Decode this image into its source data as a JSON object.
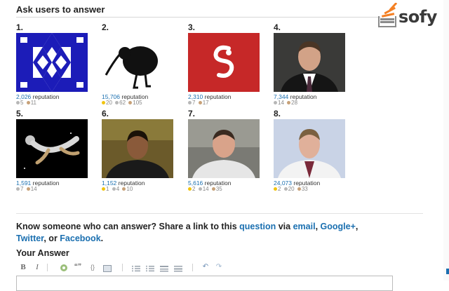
{
  "header": {
    "title": "Ask users to answer"
  },
  "logo": {
    "text": "sofy",
    "mark": "stack-icon"
  },
  "colors": {
    "link": "#1a6fb0",
    "gold": "#f1c40f",
    "silver": "#b7b7b7",
    "bronze": "#c7a178"
  },
  "users": [
    {
      "rank": "1.",
      "rep": "2,026",
      "rep_label": "reputation",
      "badges": [
        {
          "type": "silver",
          "count": "5"
        },
        {
          "type": "bronze",
          "count": "11"
        }
      ]
    },
    {
      "rank": "2.",
      "rep": "15,706",
      "rep_label": "reputation",
      "badges": [
        {
          "type": "gold",
          "count": "20"
        },
        {
          "type": "silver",
          "count": "62"
        },
        {
          "type": "bronze",
          "count": "105"
        }
      ]
    },
    {
      "rank": "3.",
      "rep": "2,310",
      "rep_label": "reputation",
      "badges": [
        {
          "type": "silver",
          "count": "7"
        },
        {
          "type": "bronze",
          "count": "17"
        }
      ]
    },
    {
      "rank": "4.",
      "rep": "7,344",
      "rep_label": "reputation",
      "badges": [
        {
          "type": "silver",
          "count": "14"
        },
        {
          "type": "bronze",
          "count": "28"
        }
      ]
    },
    {
      "rank": "5.",
      "rep": "1,591",
      "rep_label": "reputation",
      "badges": [
        {
          "type": "silver",
          "count": "7"
        },
        {
          "type": "bronze",
          "count": "14"
        }
      ]
    },
    {
      "rank": "6.",
      "rep": "1,152",
      "rep_label": "reputation",
      "badges": [
        {
          "type": "gold",
          "count": "1"
        },
        {
          "type": "silver",
          "count": "4"
        },
        {
          "type": "bronze",
          "count": "10"
        }
      ]
    },
    {
      "rank": "7.",
      "rep": "5,616",
      "rep_label": "reputation",
      "badges": [
        {
          "type": "gold",
          "count": "2"
        },
        {
          "type": "silver",
          "count": "14"
        },
        {
          "type": "bronze",
          "count": "35"
        }
      ]
    },
    {
      "rank": "8.",
      "rep": "24,073",
      "rep_label": "reputation",
      "badges": [
        {
          "type": "gold",
          "count": "2"
        },
        {
          "type": "silver",
          "count": "20"
        },
        {
          "type": "bronze",
          "count": "33"
        }
      ]
    }
  ],
  "share": {
    "prefix": "Know someone who can answer? Share a link to this",
    "question_link": "question",
    "via": "via",
    "email_link": "email",
    "comma1": ",",
    "google_link": "Google+",
    "comma2": ",",
    "twitter_link": "Twitter",
    "or": ", or",
    "facebook_link": "Facebook",
    "period": "."
  },
  "answer": {
    "title": "Your Answer",
    "toolbar": {
      "bold": "B",
      "italic": "I",
      "link": "link-icon",
      "quote": "❝❞",
      "code": "{}",
      "image": "image-icon",
      "ol": "ordered-list-icon",
      "ul": "unordered-list-icon",
      "heading": "heading-icon",
      "hr": "horizontal-rule-icon",
      "undo": "↶",
      "redo": "↷"
    }
  }
}
